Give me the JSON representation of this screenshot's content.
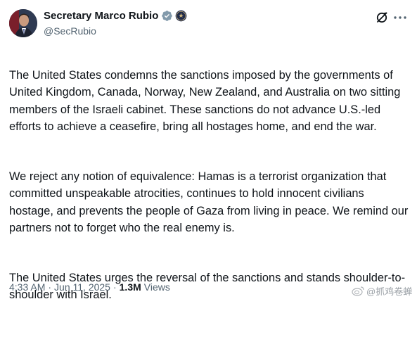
{
  "author": {
    "display_name": "Secretary Marco Rubio",
    "handle": "@SecRubio"
  },
  "icons": {
    "verified": "verified-badge-icon",
    "affiliation": "us-state-department-seal-icon",
    "grok": "grok-icon",
    "more": "more-horizontal-icon"
  },
  "tweet": {
    "paragraphs": [
      "The United States condemns the sanctions imposed by the governments of United Kingdom, Canada, Norway, New Zealand, and Australia on two sitting members of the Israeli cabinet. These sanctions do not advance U.S.-led efforts to achieve a ceasefire, bring all hostages home, and end the war.",
      "We reject any notion of equivalence: Hamas is a terrorist organization that committed unspeakable atrocities, continues to hold innocent civilians hostage, and prevents the people of Gaza from living in peace. We remind our partners not to forget who the real enemy is.",
      "The United States urges the reversal of the sanctions and stands shoulder-to-shoulder with Israel."
    ],
    "time": "4:33 AM",
    "separator": "·",
    "date": "Jun 11, 2025",
    "views_count": "1.3M",
    "views_label": "Views"
  },
  "watermark": {
    "text": "@抓鸡卷蝉"
  },
  "colors": {
    "verified_badge": "#829aab",
    "text_primary": "#0f1419",
    "text_secondary": "#536471"
  }
}
